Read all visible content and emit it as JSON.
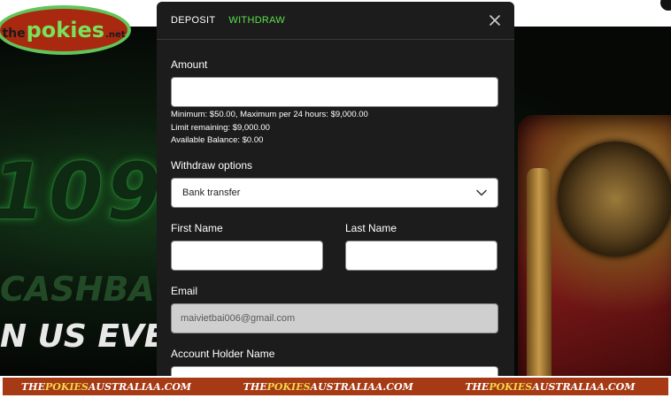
{
  "logo": {
    "the": "the",
    "main": "pokies",
    "net": ".net"
  },
  "hero": {
    "big_text": "109",
    "cash_text": "CASHBA",
    "join_text": "N US EVERY"
  },
  "modal": {
    "tabs": [
      {
        "label": "DEPOSIT",
        "active": false
      },
      {
        "label": "WITHDRAW",
        "active": true
      }
    ],
    "close_icon": "close-icon",
    "amount": {
      "label": "Amount",
      "value": "",
      "hints": [
        "Minimum: $50.00, Maximum per 24 hours: $9,000.00",
        "Limit remaining: $9,000.00",
        "Available Balance: $0.00"
      ]
    },
    "withdraw_options": {
      "label": "Withdraw options",
      "selected": "Bank transfer",
      "icon": "chevron-down-icon"
    },
    "first_name": {
      "label": "First Name",
      "value": ""
    },
    "last_name": {
      "label": "Last Name",
      "value": ""
    },
    "email": {
      "label": "Email",
      "value": "maivietbai006@gmail.com"
    },
    "account_holder": {
      "label": "Account Holder Name",
      "value": ""
    }
  },
  "ticker": {
    "items": [
      {
        "pre": "THE",
        "hl": "POKIES",
        "post": "AUSTRALIAA.COM"
      },
      {
        "pre": "THE",
        "hl": "POKIES",
        "post": "AUSTRALIAA.COM"
      },
      {
        "pre": "THE",
        "hl": "POKIES",
        "post": "AUSTRALIAA.COM"
      }
    ]
  },
  "colors": {
    "accent": "#5be04a",
    "modal_bg": "#1c1c1c",
    "ticker_bg": "#a63a14"
  }
}
